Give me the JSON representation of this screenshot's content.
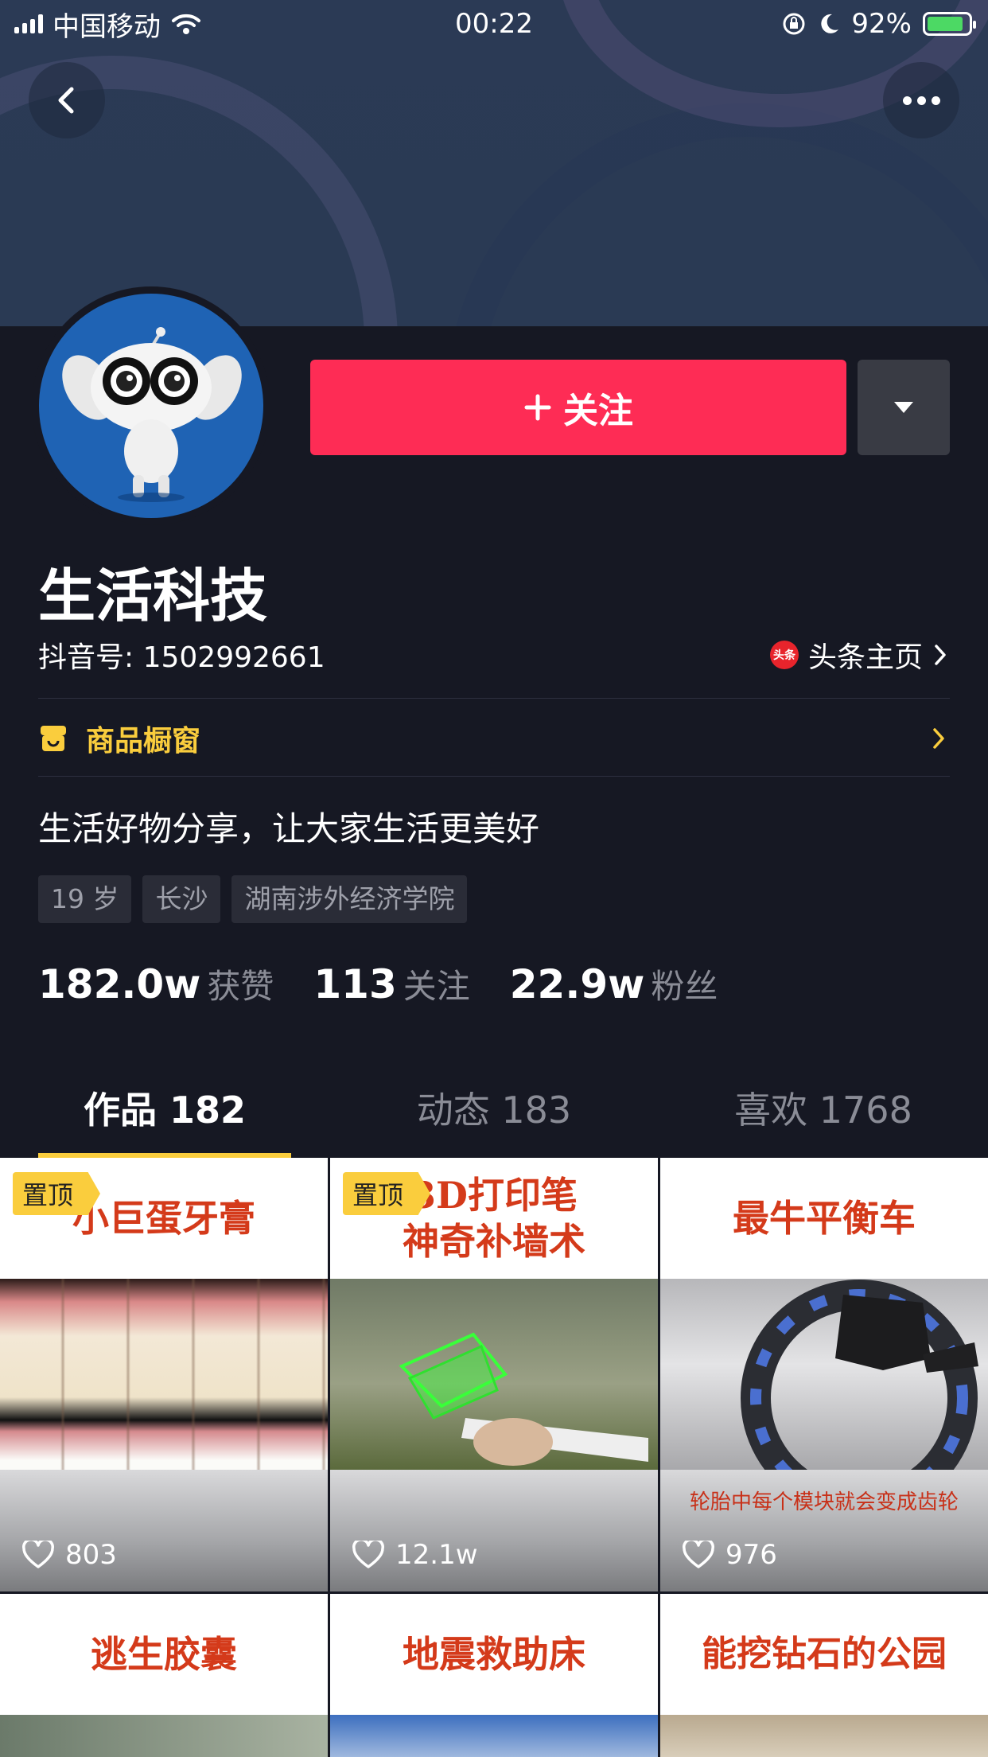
{
  "status_bar": {
    "carrier": "中国移动",
    "time": "00:22",
    "battery": "92%",
    "battery_level": 0.92
  },
  "profile": {
    "name": "生活科技",
    "douyin_id": "抖音号: 1502992661",
    "toutiao_label": "头条主页",
    "toutiao_badge": "头条",
    "follow_label": "关注",
    "shop_label": "商品橱窗",
    "bio": "生活好物分享，让大家生活更美好",
    "tags": [
      "19 岁",
      "长沙",
      "湖南涉外经济学院"
    ]
  },
  "stats": [
    {
      "num": "182.0w",
      "label": "获赞"
    },
    {
      "num": "113",
      "label": "关注"
    },
    {
      "num": "22.9w",
      "label": "粉丝"
    }
  ],
  "tabs": [
    {
      "label": "作品 182",
      "active": true
    },
    {
      "label": "动态 183",
      "active": false
    },
    {
      "label": "喜欢 1768",
      "active": false
    }
  ],
  "videos": [
    {
      "caption": "小巨蛋牙膏",
      "pinned": "置顶",
      "likes": "803",
      "subtitle": ""
    },
    {
      "caption": "3D打印笔\n神奇补墙术",
      "pinned": "置顶",
      "likes": "12.1w",
      "subtitle": ""
    },
    {
      "caption": "最牛平衡车",
      "pinned": "",
      "likes": "976",
      "subtitle": "轮胎中每个模块就会变成齿轮"
    },
    {
      "caption": "逃生胶囊",
      "pinned": "",
      "likes": "",
      "subtitle": ""
    },
    {
      "caption": "地震救助床",
      "pinned": "",
      "likes": "",
      "subtitle": ""
    },
    {
      "caption": "能挖钻石的公园",
      "pinned": "",
      "likes": "",
      "subtitle": ""
    }
  ],
  "colors": {
    "accent": "#fe2c55",
    "gold": "#facd3d",
    "background": "#161823"
  }
}
